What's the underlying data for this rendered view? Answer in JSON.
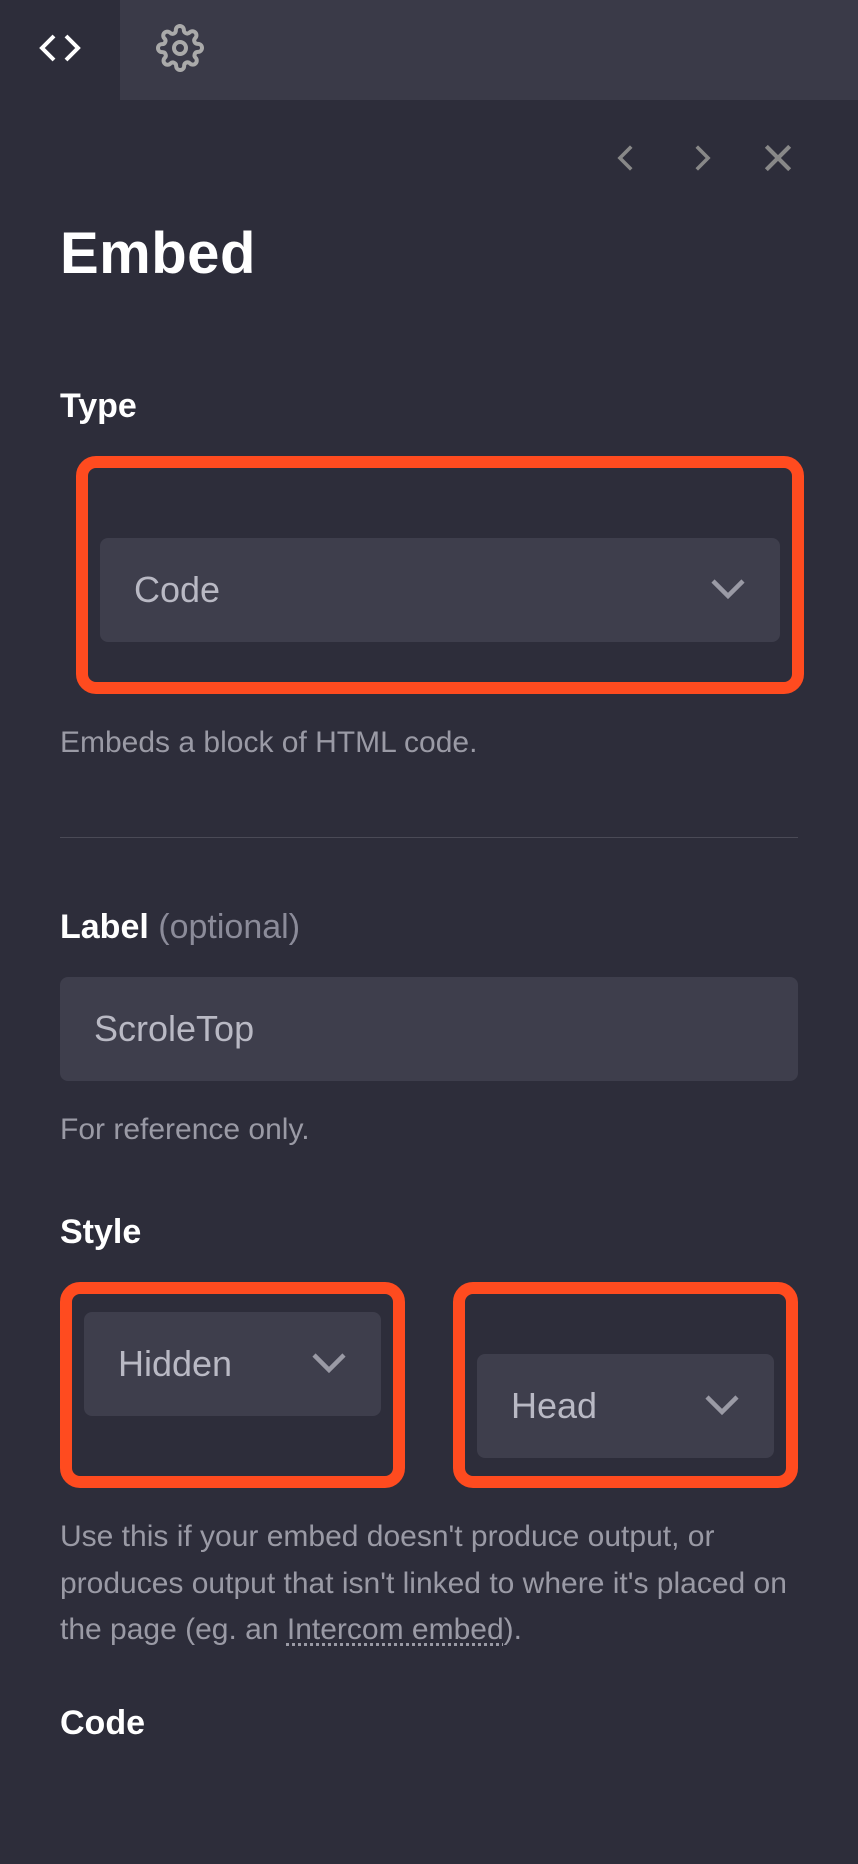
{
  "title": "Embed",
  "type": {
    "label": "Type",
    "value": "Code",
    "helper": "Embeds a block of HTML code."
  },
  "label_field": {
    "label": "Label",
    "optional": "(optional)",
    "value": "ScroleTop",
    "helper": "For reference only."
  },
  "style": {
    "label": "Style",
    "value": "Hidden",
    "position_value": "Head",
    "helper_pre": "Use this if your embed doesn't produce output, or produces output that isn't linked to where it's placed on the page (eg. an ",
    "helper_link": "Intercom embed",
    "helper_post": ")."
  },
  "code": {
    "label": "Code"
  }
}
